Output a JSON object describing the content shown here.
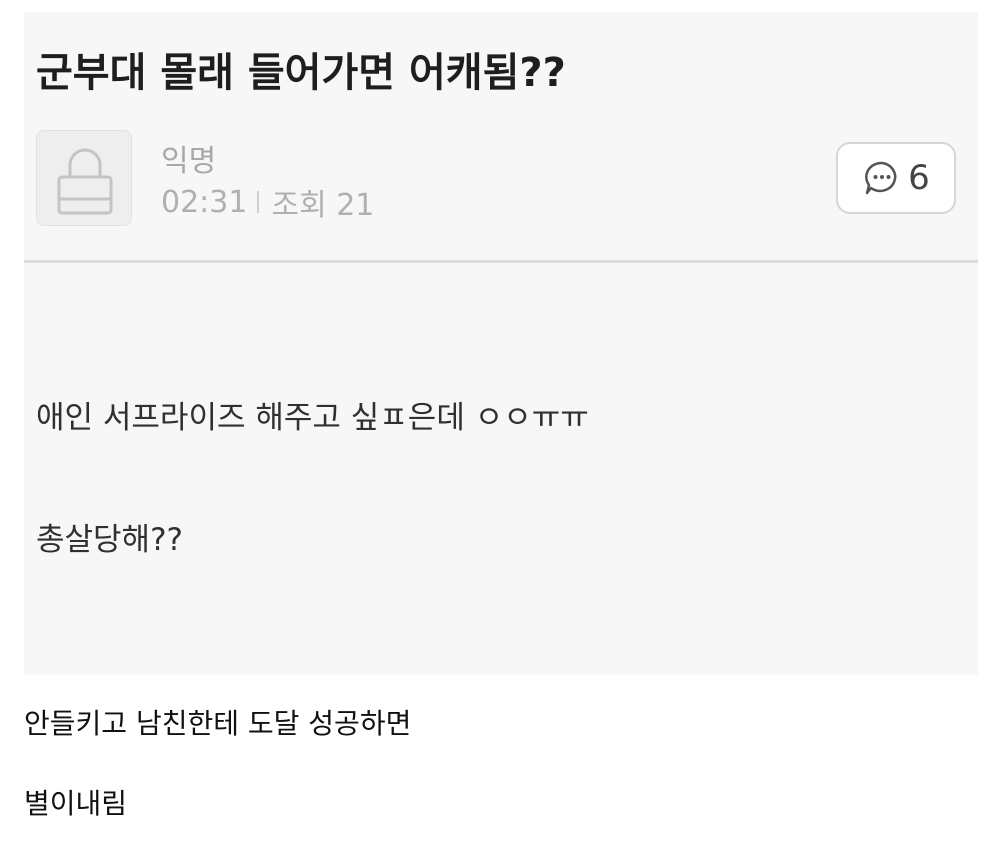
{
  "post": {
    "title": "군부대 몰래 들어가면 어캐됨??",
    "author": "익명",
    "time": "02:31",
    "views_label": "조회 21",
    "comment_count": "6",
    "body_lines": [
      "애인 서프라이즈 해주고 싶ㅍ은데 ㅇㅇㅠㅠ",
      "총살당해??"
    ]
  },
  "caption": {
    "lines": [
      "안들키고 남친한테 도달 성공하면",
      "별이내림"
    ]
  },
  "icons": {
    "avatar": "lock-icon",
    "comment": "speech-bubble-icon"
  },
  "colors": {
    "card_background": "#f7f7f7",
    "meta_text": "#b0b0b0",
    "title_text": "#1e1e1e"
  }
}
